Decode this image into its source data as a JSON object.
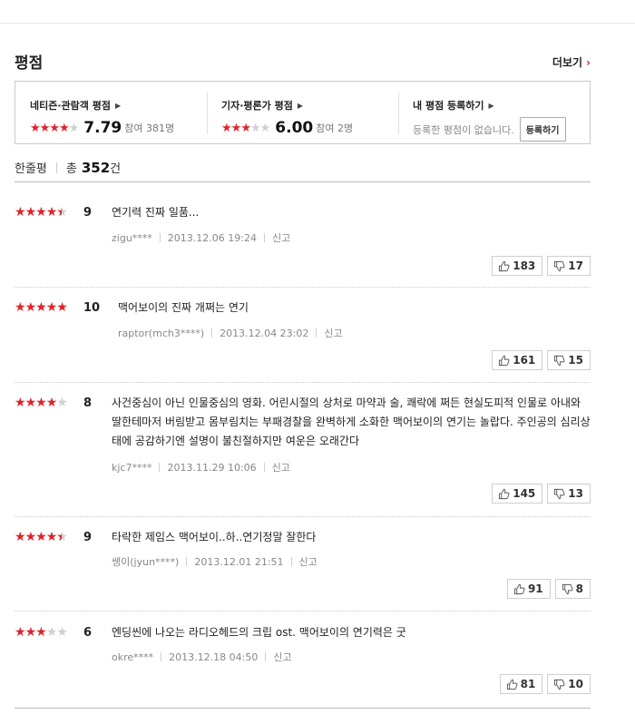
{
  "section": {
    "title": "평점",
    "more_label": "더보기"
  },
  "rating_box": {
    "netizen": {
      "title": "네티즌·관람객 평점",
      "stars": 4,
      "score": "7.79",
      "count": "참여 381명"
    },
    "critic": {
      "title": "기자·평론가 평점",
      "stars": 3,
      "score": "6.00",
      "count": "참여 2명"
    },
    "mine": {
      "title": "내 평점 등록하기",
      "empty_text": "등록한 평점이 없습니다.",
      "button_label": "등록하기"
    }
  },
  "list_header": {
    "label": "한줄평",
    "total_label": "총",
    "total_count": "352",
    "unit": "건"
  },
  "reviews": [
    {
      "stars": 4.5,
      "score": "9",
      "text": "연기력 진짜 일품...",
      "user": "zigu****",
      "date": "2013.12.06 19:24",
      "report": "신고",
      "likes": "183",
      "dislikes": "17"
    },
    {
      "stars": 5,
      "score": "10",
      "text": "맥어보이의 진짜 개쩌는 연기",
      "user": "raptor(mch3****)",
      "date": "2013.12.04 23:02",
      "report": "신고",
      "likes": "161",
      "dislikes": "15"
    },
    {
      "stars": 4,
      "score": "8",
      "text": "사건중심이 아닌 인물중심의 영화. 어린시절의 상처로 마약과 술, 쾌락에 쩌든 현실도피적 인물로 아내와 딸한테마저 버림받고 몸부림치는 부패경찰을 완벽하게 소화한 맥어보이의 연기는 놀랍다. 주인공의 심리상태에 공감하기엔 설명이 불친절하지만 여운은 오래간다",
      "user": "kjc7****",
      "date": "2013.11.29 10:06",
      "report": "신고",
      "likes": "145",
      "dislikes": "13"
    },
    {
      "stars": 4.5,
      "score": "9",
      "text": "타락한 제임스 맥어보이..하..연기정말 잘한다",
      "user": "쌩이(jyun****)",
      "date": "2013.12.01 21:51",
      "report": "신고",
      "likes": "91",
      "dislikes": "8"
    },
    {
      "stars": 3,
      "score": "6",
      "text": "엔딩씬에 나오는 라디오헤드의 크립 ost. 맥어보이의 연기력은 굿",
      "user": "okre****",
      "date": "2013.12.18 04:50",
      "report": "신고",
      "likes": "81",
      "dislikes": "10"
    }
  ],
  "colors": {
    "accent": "#e0222a",
    "star_off": "#d0d0d0"
  }
}
